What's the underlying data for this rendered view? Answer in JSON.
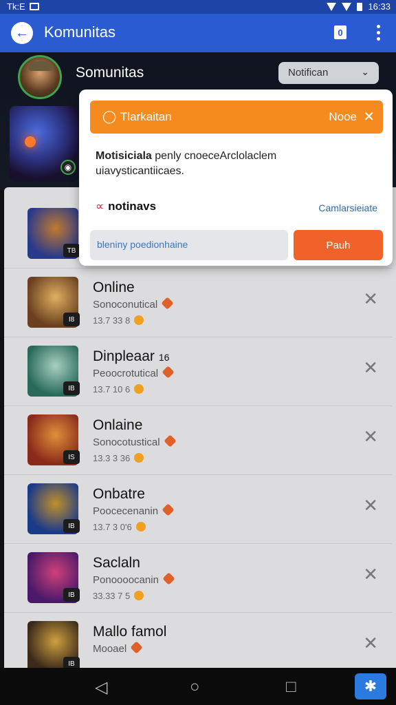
{
  "status_bar": {
    "left_label": "Tk:E",
    "time": "16:33"
  },
  "app_bar": {
    "title": "Komunitas",
    "calendar_label": "0"
  },
  "hero": {
    "title": "Somunitas",
    "dropdown_value": "Notifican"
  },
  "popup": {
    "banner_title": "Tlarkaitan",
    "banner_right": "Nooe",
    "message_bold": "Motisiciala",
    "message_rest": " penly cnoeceArclolaclem",
    "message_line2": "uiavysticantiicaes.",
    "notif_label": "notinavs",
    "change_link": "Camlarsieiate",
    "input_placeholder": "bleniny poedionhaine",
    "push_label": "Pauh"
  },
  "list": [
    {
      "name": "",
      "sub": "",
      "meta": "",
      "badge": "TB",
      "colors": [
        "#2a3a8a",
        "#c07a30"
      ]
    },
    {
      "name": "Online",
      "sub": "Sonoconutical",
      "meta": "13.7 33 8",
      "badge": "I8",
      "colors": [
        "#6a4020",
        "#e0b060"
      ]
    },
    {
      "name": "Dinpleaar",
      "name_suffix": "16",
      "sub": "Peoocrotutical",
      "meta": "13.7 10 6",
      "badge": "IB",
      "colors": [
        "#2a6a5a",
        "#a8d0c0"
      ]
    },
    {
      "name": "Onlaine",
      "sub": "Sonocotustical",
      "meta": "13.3 3 36",
      "badge": "IS",
      "colors": [
        "#8a2a1a",
        "#e0903a"
      ]
    },
    {
      "name": "Onbatre",
      "sub": "Poocecenanin",
      "meta": "13.7 3 0'6",
      "badge": "IB",
      "colors": [
        "#1a3a8a",
        "#c0902a"
      ]
    },
    {
      "name": "Saclaln",
      "sub": "Ponoooocanin",
      "meta": "33.33 7 5",
      "badge": "IB",
      "colors": [
        "#4a1a6a",
        "#d0407a"
      ]
    },
    {
      "name": "Mallo famol",
      "sub": "Mooael",
      "meta": "",
      "badge": "IB",
      "colors": [
        "#3a2a1a",
        "#d0a040"
      ]
    }
  ],
  "nav": {
    "back": "back-nav",
    "home": "home-nav",
    "recent": "recent-nav"
  }
}
